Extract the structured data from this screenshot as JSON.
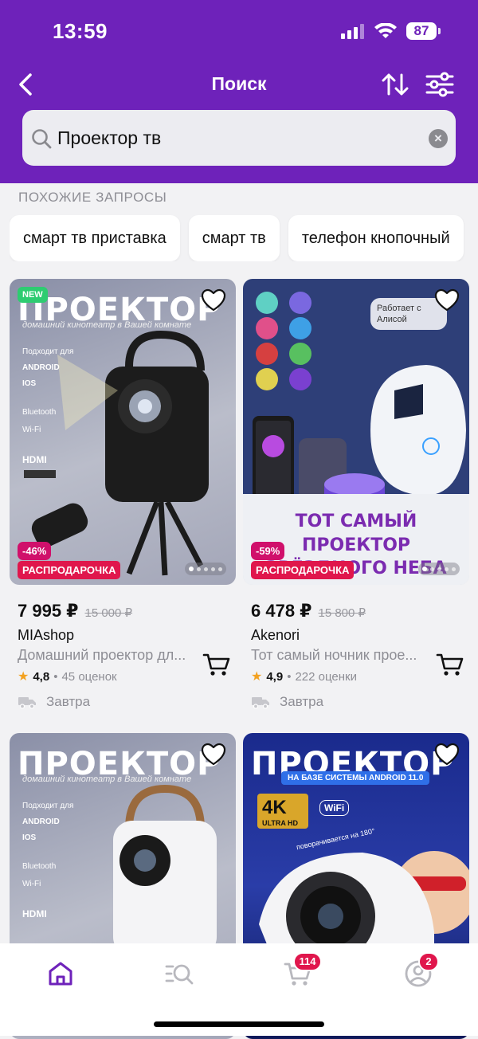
{
  "status_bar": {
    "time": "13:59",
    "battery": "87"
  },
  "header": {
    "title": "Поиск"
  },
  "search": {
    "value": "Проектор тв",
    "clear_label": "×"
  },
  "similar": {
    "title": "ПОХОЖИЕ ЗАПРОСЫ",
    "chips": [
      "смарт тв приставка",
      "смарт тв",
      "телефон кнопочный"
    ]
  },
  "products": [
    {
      "image": {
        "new_badge": "NEW",
        "headline": "ПРОЕКТОР",
        "subline": "домашний кинотеатр в Вашей комнате",
        "spec1": "Подходит для",
        "spec2": "ANDROID",
        "spec3": "IOS",
        "spec4": "Bluetooth",
        "spec5": "Wi-Fi",
        "spec6": "HDMI"
      },
      "discount": "-46%",
      "sale_label": "РАСПРОДАРОЧКА",
      "price": "7 995 ₽",
      "old_price": "15 000 ₽",
      "seller": "MIAshop",
      "description": "Домашний проектор дл...",
      "rating": "4,8",
      "reviews": "45 оценок",
      "delivery": "Завтра"
    },
    {
      "image": {
        "alice_tag": "Работает с Алисой",
        "banner": "ТОТ САМЫЙ ПРОЕКТОР ЗВЁЗДНОГО НЕБА"
      },
      "discount": "-59%",
      "sale_label": "РАСПРОДАРОЧКА",
      "price": "6 478 ₽",
      "old_price": "15 800 ₽",
      "seller": "Akenori",
      "description": "Тот самый ночник прое...",
      "rating": "4,9",
      "reviews": "222 оценки",
      "delivery": "Завтра"
    },
    {
      "image": {
        "headline": "ПРОЕКТОР",
        "subline": "домашний кинотеатр в Вашей комнате",
        "spec1": "Подходит для",
        "spec2": "ANDROID",
        "spec3": "IOS",
        "spec4": "Bluetooth",
        "spec5": "Wi-Fi",
        "spec6": "HDMI"
      }
    },
    {
      "image": {
        "headline": "ПРОЕКТОР",
        "subline": "НА БАЗЕ СИСТЕМЫ ANDROID 11.0",
        "tag_4k": "4K",
        "tag_uhd": "ULTRA HD",
        "tag_wifi": "WiFi",
        "rotate": "поворачивается на 180°"
      }
    }
  ],
  "bottom_nav": {
    "cart_badge": "114",
    "profile_badge": "2"
  },
  "colors": {
    "brand": "#6e22ba",
    "sale": "#e0164c",
    "discount": "#d0106b",
    "star": "#f3a221"
  }
}
